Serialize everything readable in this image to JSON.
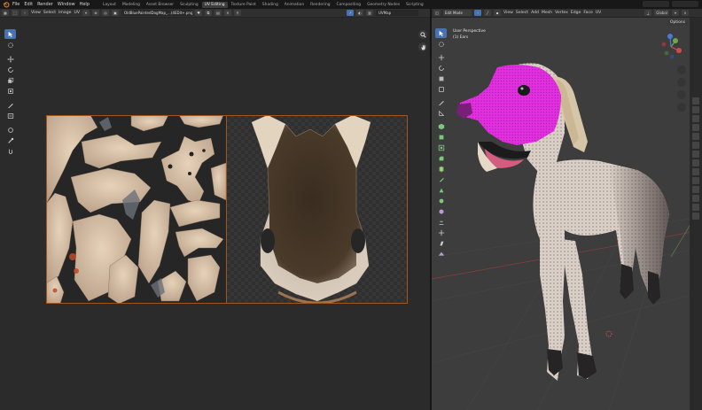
{
  "menu": [
    "File",
    "Edit",
    "Render",
    "Window",
    "Help"
  ],
  "workspaces": [
    {
      "label": "Layout",
      "active": false
    },
    {
      "label": "Modeling",
      "active": false
    },
    {
      "label": "Asset Browser",
      "active": false
    },
    {
      "label": "Sculpting",
      "active": false
    },
    {
      "label": "UV Editing",
      "active": true
    },
    {
      "label": "Texture Paint",
      "active": false
    },
    {
      "label": "Shading",
      "active": false
    },
    {
      "label": "Animation",
      "active": false
    },
    {
      "label": "Rendering",
      "active": false
    },
    {
      "label": "Compositing",
      "active": false
    },
    {
      "label": "Geometry Nodes",
      "active": false
    },
    {
      "label": "Scripting",
      "active": false
    }
  ],
  "uv_editor": {
    "header_menu": [
      "View",
      "Select",
      "Image",
      "UV"
    ],
    "image_name": "OldBluePaintedDogMap_...(4EDit+.png",
    "uv_map": "UVMap"
  },
  "viewport": {
    "mode": "Edit Mode",
    "header_menu": [
      "View",
      "Select",
      "Add",
      "Mesh",
      "Vertex",
      "Edge",
      "Face",
      "UV"
    ],
    "orientation": "Global",
    "options": "Options",
    "perspective": "User Perspective",
    "object": "(1) Ears"
  },
  "colors": {
    "accent": "#4772b3",
    "active_workspace": "#3d3d3d",
    "selection": "#e01fe0",
    "tile_border": "#a0561d"
  }
}
